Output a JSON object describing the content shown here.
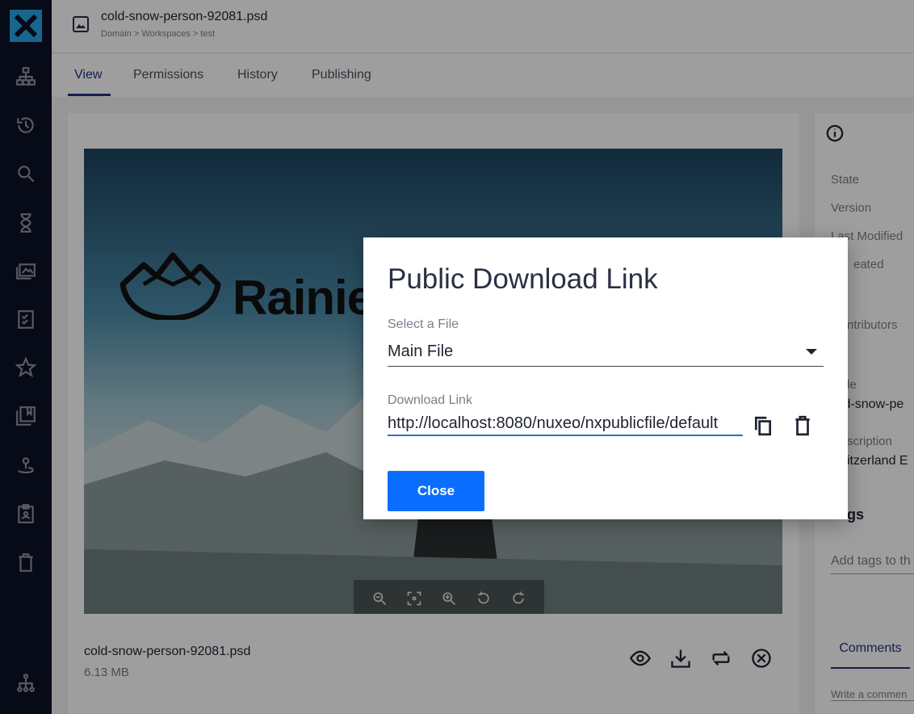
{
  "sidebar": {
    "logo_icon": "nuxeo-x-logo",
    "items": [
      {
        "icon": "sitemap-icon"
      },
      {
        "icon": "history-icon"
      },
      {
        "icon": "search-icon"
      },
      {
        "icon": "hourglass-icon"
      },
      {
        "icon": "gallery-icon"
      },
      {
        "icon": "checklist-icon"
      },
      {
        "icon": "star-icon"
      },
      {
        "icon": "collections-icon"
      },
      {
        "icon": "personal-workspace-icon"
      },
      {
        "icon": "clipboard-icon"
      },
      {
        "icon": "trash-icon"
      },
      {
        "icon": "admin-sitemap-icon"
      }
    ]
  },
  "header": {
    "title": "cold-snow-person-92081.psd",
    "breadcrumb": "Domain > Workspaces > test"
  },
  "tabs": [
    {
      "label": "View",
      "active": true
    },
    {
      "label": "Permissions"
    },
    {
      "label": "History"
    },
    {
      "label": "Publishing"
    }
  ],
  "preview": {
    "brand_text": "Rainie",
    "zoom_controls": [
      "zoom-out-icon",
      "fit-icon",
      "zoom-in-icon",
      "rotate-left-icon",
      "rotate-right-icon"
    ]
  },
  "file": {
    "name": "cold-snow-person-92081.psd",
    "size": "6.13 MB"
  },
  "right_panel": {
    "labels": [
      "State",
      "Version",
      "Last Modified",
      "eated",
      "ntributors",
      "le",
      "scription"
    ],
    "title_value": "ld-snow-pe",
    "description_value": "vitzerland E",
    "tags_heading": "gs",
    "tags_placeholder": "Add tags to th",
    "comments_tab": "Comments",
    "comment_placeholder": "Write a commen"
  },
  "dialog": {
    "title": "Public Download Link",
    "select_label": "Select a File",
    "select_value": "Main File",
    "link_label": "Download Link",
    "link_value": "http://localhost:8080/nuxeo/nxpublicfile/default",
    "close_label": "Close"
  },
  "colors": {
    "sidebar_bg": "#0c1328",
    "accent": "#203080",
    "primary_button": "#0a6eff",
    "input_focus": "#2a6fd6"
  }
}
